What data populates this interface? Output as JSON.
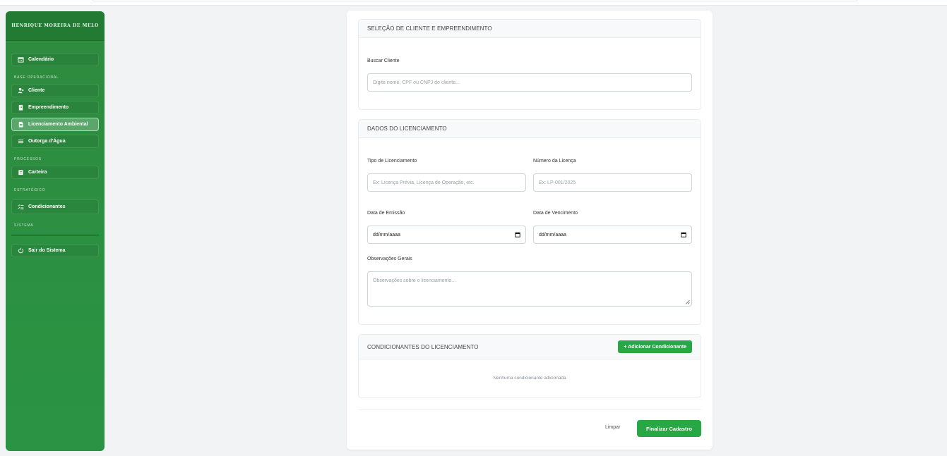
{
  "sidebar": {
    "user_name": "HENRIQUE MOREIRA DE MELO",
    "items": {
      "calendar": "Calendário",
      "client": "Cliente",
      "enterprise": "Empreendimento",
      "licensing": "Licenciamento Ambiental",
      "water": "Outorga d'Água",
      "portfolio": "Carteira",
      "conditions": "Condicionantes",
      "logout": "Sair do Sistema"
    },
    "sections": {
      "base": "BASE OPERACIONAL",
      "processes": "PROCESSOS",
      "strategic": "ESTRATÉGICO",
      "system": "SISTEMA"
    },
    "active_item": "licensing",
    "accent": "#28a745"
  },
  "form": {
    "client_section": {
      "title": "SELEÇÃO DE CLIENTE E EMPREENDIMENTO",
      "search_label": "Buscar Cliente",
      "search_placeholder": "Digite nome, CPF ou CNPJ do cliente..."
    },
    "license_section": {
      "title": "DADOS DO LICENCIAMENTO",
      "type_label": "Tipo de Licenciamento",
      "type_placeholder": "Ex: Licença Prévia, Licença de Operação, etc.",
      "number_label": "Número da Licença",
      "number_placeholder": "Ex: LP-001/2025",
      "issue_label": "Data de Emissão",
      "issue_value": "dd/mm/aaaa",
      "due_label": "Data de Vencimento",
      "due_value": "dd/mm/aaaa",
      "notes_label": "Observações Gerais",
      "notes_placeholder": "Observações sobre o licenciamento..."
    },
    "conditions_section": {
      "title": "CONDICIONANTES DO LICENCIAMENTO",
      "add_button": "+ Adicionar Condicionante",
      "empty_text": "Nenhuma condicionante adicionada"
    },
    "actions": {
      "clear": "Limpar",
      "submit": "Finalizar Cadastro"
    }
  }
}
